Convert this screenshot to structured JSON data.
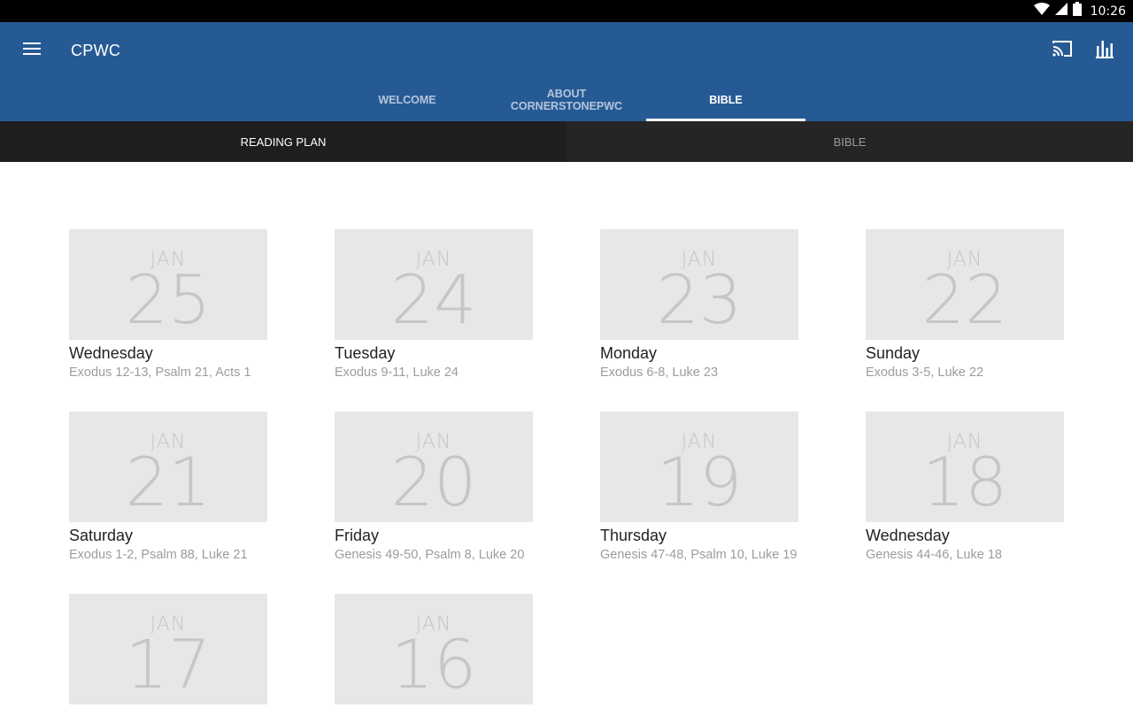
{
  "status": {
    "time": "10:26"
  },
  "app_bar": {
    "title": "CPWC"
  },
  "tabs": [
    {
      "label": "WELCOME"
    },
    {
      "label": "ABOUT\nCORNERSTONEPWC"
    },
    {
      "label": "BIBLE"
    }
  ],
  "subtabs": [
    {
      "label": "READING PLAN"
    },
    {
      "label": "BIBLE"
    }
  ],
  "readings": [
    {
      "month": "JAN",
      "day": "25",
      "weekday": "Wednesday",
      "passages": "Exodus 12-13, Psalm 21, Acts 1"
    },
    {
      "month": "JAN",
      "day": "24",
      "weekday": "Tuesday",
      "passages": "Exodus 9-11, Luke 24"
    },
    {
      "month": "JAN",
      "day": "23",
      "weekday": "Monday",
      "passages": "Exodus 6-8, Luke 23"
    },
    {
      "month": "JAN",
      "day": "22",
      "weekday": "Sunday",
      "passages": "Exodus 3-5, Luke 22"
    },
    {
      "month": "JAN",
      "day": "21",
      "weekday": "Saturday",
      "passages": "Exodus 1-2, Psalm 88, Luke 21"
    },
    {
      "month": "JAN",
      "day": "20",
      "weekday": "Friday",
      "passages": "Genesis 49-50, Psalm 8, Luke 20"
    },
    {
      "month": "JAN",
      "day": "19",
      "weekday": "Thursday",
      "passages": "Genesis 47-48, Psalm 10, Luke 19"
    },
    {
      "month": "JAN",
      "day": "18",
      "weekday": "Wednesday",
      "passages": "Genesis 44-46, Luke 18"
    },
    {
      "month": "JAN",
      "day": "17",
      "weekday": "",
      "passages": ""
    },
    {
      "month": "JAN",
      "day": "16",
      "weekday": "",
      "passages": ""
    }
  ],
  "icons": {
    "menu": "menu-icon",
    "cast": "cast-icon",
    "stats": "bar-chart-icon",
    "wifi": "wifi-icon",
    "signal": "cell-signal-icon",
    "battery": "battery-icon"
  },
  "colors": {
    "app_bar": "#265a94",
    "subtab_bar": "#252525",
    "tile": "#e7e7e7"
  }
}
